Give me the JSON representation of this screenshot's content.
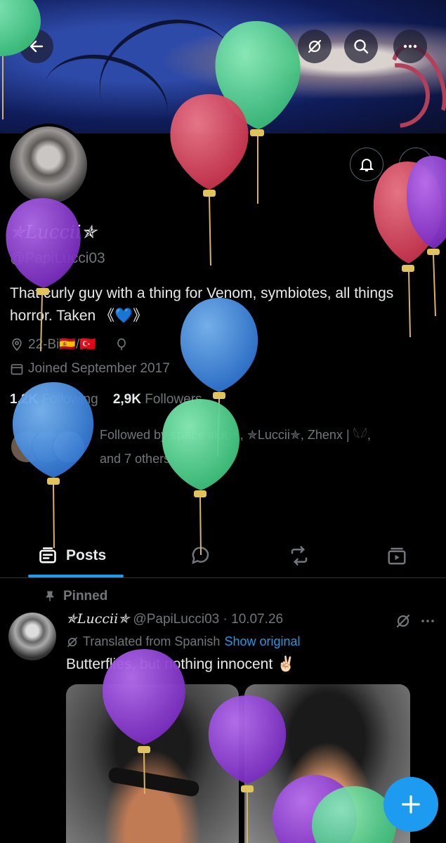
{
  "header": {
    "back_label": "Back",
    "translate_label": "Translate",
    "search_label": "Search",
    "more_label": "More"
  },
  "profile": {
    "display_name": "✯Luccii✯",
    "handle": "@PapiLucci03",
    "bio": "That curly guy with a thing for Venom, symbiotes, all things horror. Taken 《💙》",
    "location": "22-Bi🇪🇸/🇹🇷",
    "joined": "Joined September 2017",
    "following_count": "1,2K",
    "following_label": "Following",
    "followers_count": "2,9K",
    "followers_label": "Followers",
    "followed_by": "Followed by space slut ⚡, ✯Luccii✯, Zhenx | 𓆩𓆪,",
    "followed_more": "and 7 others"
  },
  "tabs": [
    {
      "label": "Posts",
      "active": true
    },
    {
      "label": "Replies"
    },
    {
      "label": "Reposts"
    },
    {
      "label": "Media"
    }
  ],
  "pinned_post": {
    "pinned_label": "Pinned",
    "author_name": "✯Luccii✯",
    "author_handle": "@PapiLucci03",
    "date": "10.07.26",
    "translated_label": "Translated from Spanish",
    "show_original": "Show original",
    "text": "Butterflies, but nothing innocent ✌🏻"
  },
  "colors": {
    "accent": "#1d9bf0",
    "muted": "#71767b",
    "balloon_green": "#4fd18b",
    "balloon_red": "#e0455f",
    "balloon_purple": "#8e3bd4",
    "balloon_blue": "#3f87e0"
  }
}
